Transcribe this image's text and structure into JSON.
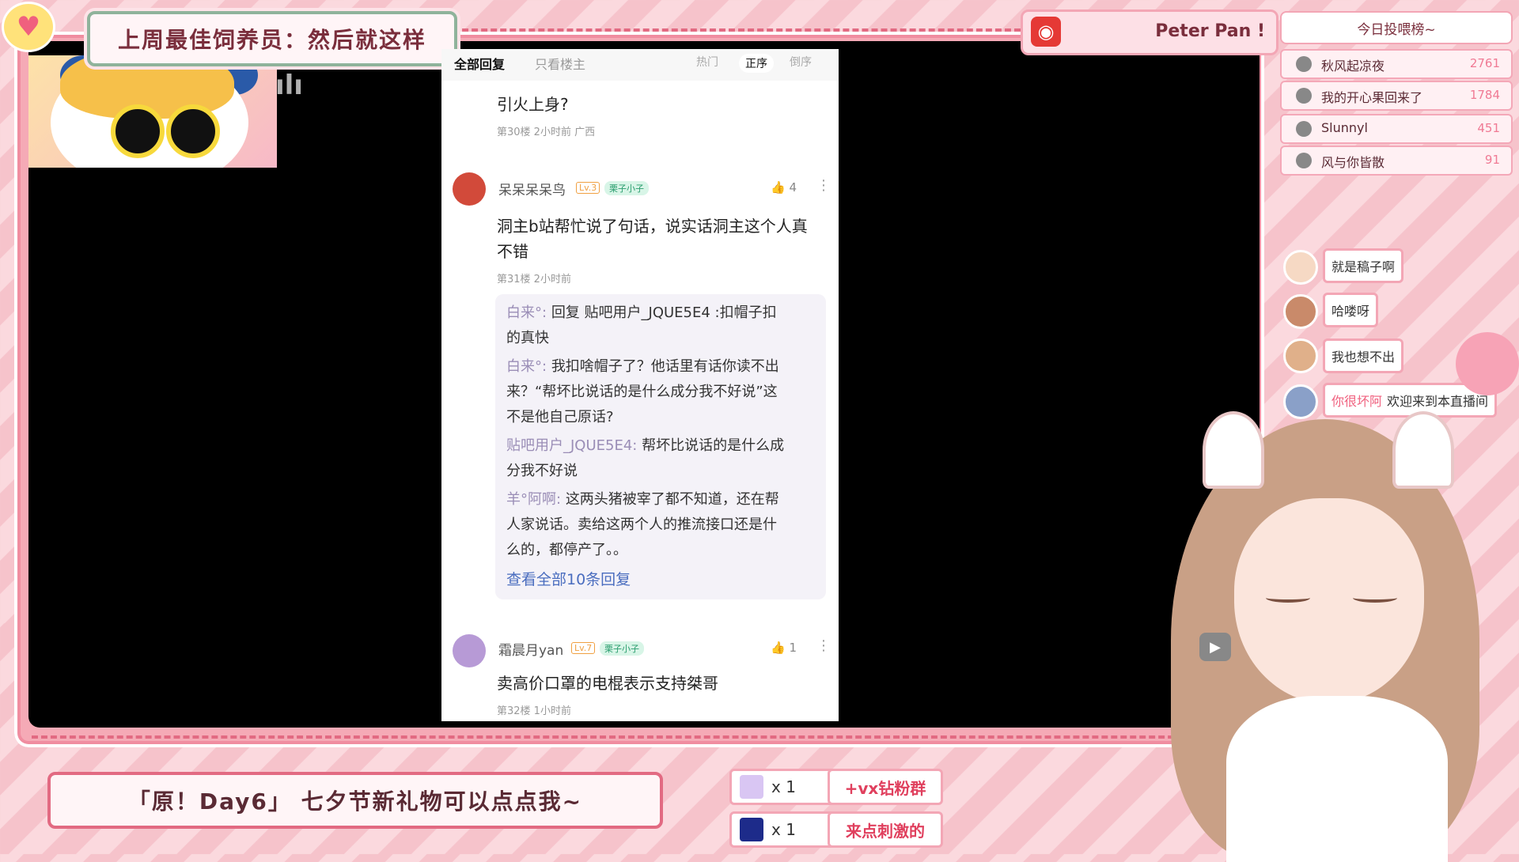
{
  "title_banner": "上周最佳饲养员：然后就这样",
  "phone": {
    "tabs": {
      "all": "全部回复",
      "host_only": "只看楼主"
    },
    "sort": {
      "hot": "热门",
      "order": "正序",
      "reverse": "倒序"
    },
    "post1": {
      "text": "引火上身?",
      "meta": "第30楼  2小时前  广西"
    },
    "post2": {
      "username": "呆呆呆呆鸟",
      "level": "Lv.3",
      "fan_badge": "栗子小子",
      "likes": "4",
      "text_line1": "洞主b站帮忙说了句话，说实话洞主这个人真",
      "text_line2": "不错",
      "meta": "第31楼  2小时前"
    },
    "replies": [
      {
        "name": "白来°:",
        "text": "回复 贴吧用户_JQUE5E4 :扣帽子扣",
        "cont": "的真快"
      },
      {
        "name": "白来°:",
        "text": "我扣啥帽子了？他话里有话你读不出",
        "cont": "来？“帮坏比说话的是什么成分我不好说”这",
        "cont2": "不是他自己原话?"
      },
      {
        "name": "贴吧用户_JQUE5E4:",
        "text": "帮坏比说话的是什么成",
        "cont": "分我不好说"
      },
      {
        "name": "羊°阿啊:",
        "text": "这两头猪被宰了都不知道，还在帮",
        "cont": "人家说话。卖给这两个人的推流接口还是什",
        "cont2": "么的，都停产了。。"
      }
    ],
    "view_all": "查看全部10条回复",
    "post3": {
      "username": "霜晨月yan",
      "level": "Lv.7",
      "fan_badge": "栗子小子",
      "likes": "1",
      "text": "卖高价口罩的电棍表示支持桀哥",
      "meta": "第32楼  1小时前"
    }
  },
  "music": {
    "icon": "netease-music-icon",
    "text": "Peter Pan !"
  },
  "rank": {
    "title": "今日投喂榜~",
    "rows": [
      {
        "name": "秋风起凉夜",
        "value": "2761"
      },
      {
        "name": "我的开心果回来了",
        "value": "1784"
      },
      {
        "name": "Slunnyl",
        "value": "451"
      },
      {
        "name": "风与你皆散",
        "value": "91"
      }
    ]
  },
  "chat": [
    {
      "text": "就是稿子啊"
    },
    {
      "text": "哈喽呀"
    },
    {
      "text": "我也想不出"
    },
    {
      "name": "你很坏阿",
      "text": "欢迎来到本直播间"
    }
  ],
  "bottom_banner": "「原！Day6」 七夕节新礼物可以点点我~",
  "gifts": [
    {
      "count": "x 1",
      "label": "+vx钻粉群"
    },
    {
      "count": "x 1",
      "label": "来点刺激的"
    }
  ],
  "colors": {
    "accent": "#f08da0",
    "bg": "#fbd9de",
    "link": "#4a6dbf"
  }
}
